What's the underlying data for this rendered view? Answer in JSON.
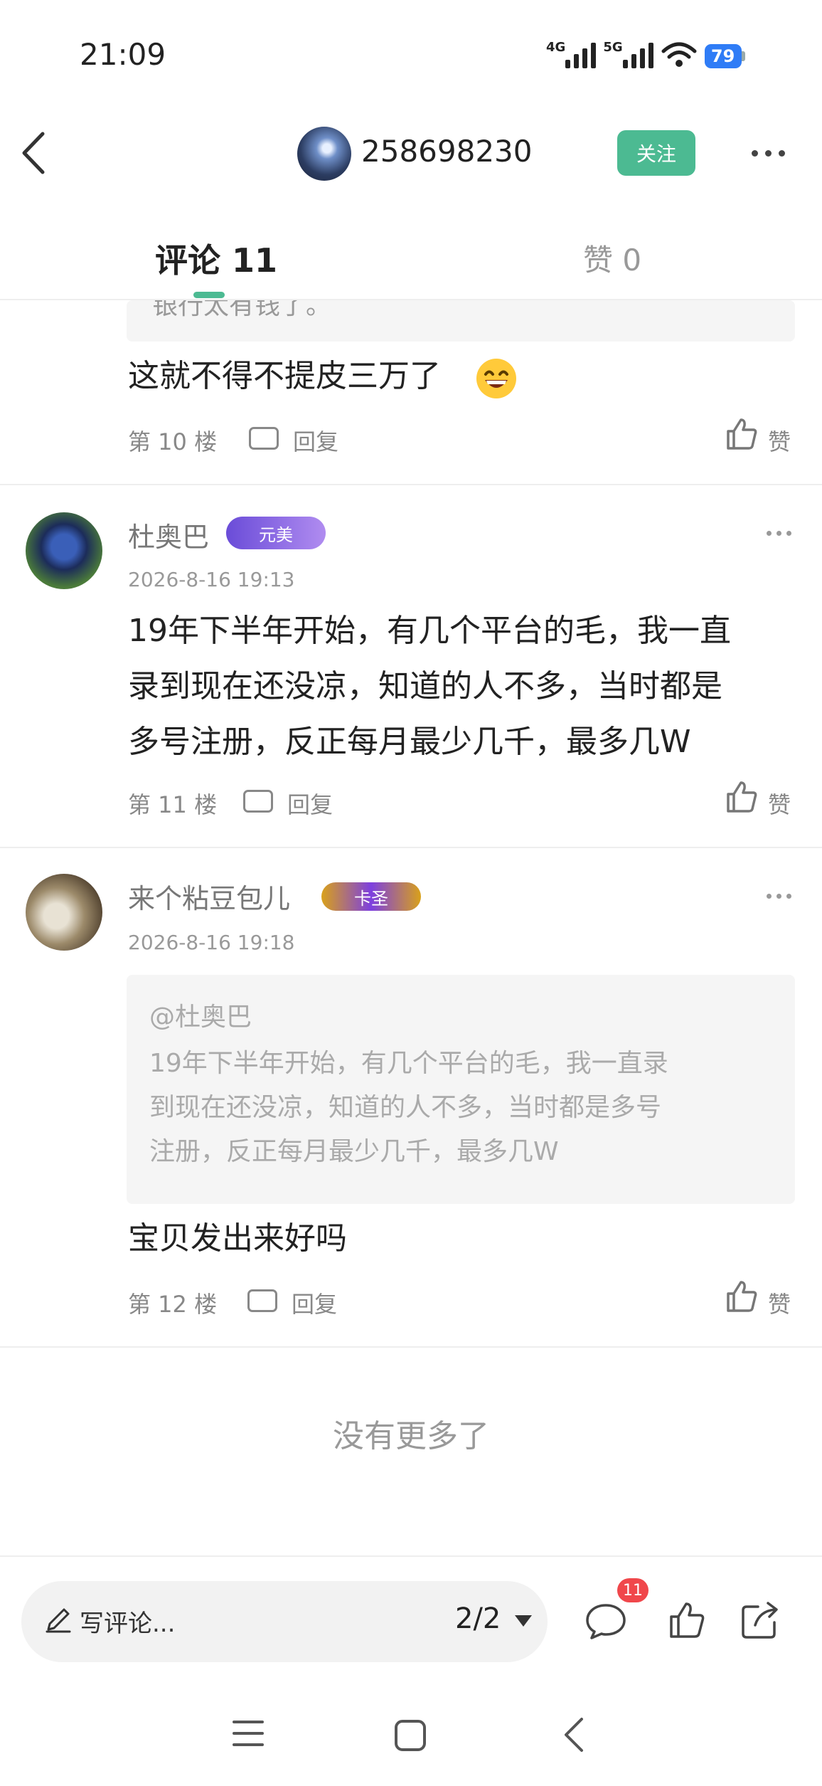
{
  "status_bar": {
    "time": "21:09",
    "network_4g": "4G",
    "network_5g": "5G",
    "battery": "79"
  },
  "header": {
    "user_id": "258698230",
    "follow_label": "关注"
  },
  "tabs": {
    "comments_label": "评论 11",
    "likes_label": "赞 0"
  },
  "comments": [
    {
      "partial_quote": "银行太有钱了。",
      "text": "这就不得不提皮三万了",
      "floor": "第 10 楼",
      "reply_label": "回复",
      "like_label": "赞"
    },
    {
      "user_name": "杜奥巴",
      "badge": "元美",
      "timestamp": "2026-8-16 19:13",
      "text_lines": [
        "19年下半年开始，有几个平台的毛，我一直",
        "录到现在还没凉，知道的人不多，当时都是",
        "多号注册，反正每月最少几千，最多几W"
      ],
      "floor": "第 11 楼",
      "reply_label": "回复",
      "like_label": "赞"
    },
    {
      "user_name": "来个粘豆包儿",
      "badge": "卡圣",
      "timestamp": "2026-8-16 19:18",
      "quote_user": "@杜奥巴",
      "quote_lines": [
        "19年下半年开始，有几个平台的毛，我一直录",
        "到现在还没凉，知道的人不多，当时都是多号",
        "注册，反正每月最少几千，最多几W"
      ],
      "text": "宝贝发出来好吗",
      "floor": "第 12 楼",
      "reply_label": "回复",
      "like_label": "赞"
    }
  ],
  "no_more_label": "没有更多了",
  "bottom_bar": {
    "write_placeholder": "写评论...",
    "page_indicator": "2/2",
    "comment_count": "11"
  },
  "colors": {
    "accent": "#4cba92",
    "badge_red": "#f0474b",
    "battery_blue": "#2f7cf6"
  }
}
